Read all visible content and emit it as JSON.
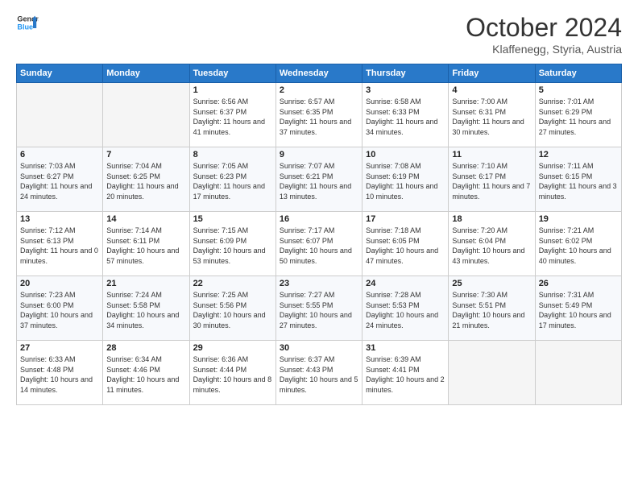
{
  "header": {
    "logo_general": "General",
    "logo_blue": "Blue",
    "month_title": "October 2024",
    "subtitle": "Klaffenegg, Styria, Austria"
  },
  "days_of_week": [
    "Sunday",
    "Monday",
    "Tuesday",
    "Wednesday",
    "Thursday",
    "Friday",
    "Saturday"
  ],
  "weeks": [
    [
      {
        "day": "",
        "sunrise": "",
        "sunset": "",
        "daylight": ""
      },
      {
        "day": "",
        "sunrise": "",
        "sunset": "",
        "daylight": ""
      },
      {
        "day": "1",
        "sunrise": "Sunrise: 6:56 AM",
        "sunset": "Sunset: 6:37 PM",
        "daylight": "Daylight: 11 hours and 41 minutes."
      },
      {
        "day": "2",
        "sunrise": "Sunrise: 6:57 AM",
        "sunset": "Sunset: 6:35 PM",
        "daylight": "Daylight: 11 hours and 37 minutes."
      },
      {
        "day": "3",
        "sunrise": "Sunrise: 6:58 AM",
        "sunset": "Sunset: 6:33 PM",
        "daylight": "Daylight: 11 hours and 34 minutes."
      },
      {
        "day": "4",
        "sunrise": "Sunrise: 7:00 AM",
        "sunset": "Sunset: 6:31 PM",
        "daylight": "Daylight: 11 hours and 30 minutes."
      },
      {
        "day": "5",
        "sunrise": "Sunrise: 7:01 AM",
        "sunset": "Sunset: 6:29 PM",
        "daylight": "Daylight: 11 hours and 27 minutes."
      }
    ],
    [
      {
        "day": "6",
        "sunrise": "Sunrise: 7:03 AM",
        "sunset": "Sunset: 6:27 PM",
        "daylight": "Daylight: 11 hours and 24 minutes."
      },
      {
        "day": "7",
        "sunrise": "Sunrise: 7:04 AM",
        "sunset": "Sunset: 6:25 PM",
        "daylight": "Daylight: 11 hours and 20 minutes."
      },
      {
        "day": "8",
        "sunrise": "Sunrise: 7:05 AM",
        "sunset": "Sunset: 6:23 PM",
        "daylight": "Daylight: 11 hours and 17 minutes."
      },
      {
        "day": "9",
        "sunrise": "Sunrise: 7:07 AM",
        "sunset": "Sunset: 6:21 PM",
        "daylight": "Daylight: 11 hours and 13 minutes."
      },
      {
        "day": "10",
        "sunrise": "Sunrise: 7:08 AM",
        "sunset": "Sunset: 6:19 PM",
        "daylight": "Daylight: 11 hours and 10 minutes."
      },
      {
        "day": "11",
        "sunrise": "Sunrise: 7:10 AM",
        "sunset": "Sunset: 6:17 PM",
        "daylight": "Daylight: 11 hours and 7 minutes."
      },
      {
        "day": "12",
        "sunrise": "Sunrise: 7:11 AM",
        "sunset": "Sunset: 6:15 PM",
        "daylight": "Daylight: 11 hours and 3 minutes."
      }
    ],
    [
      {
        "day": "13",
        "sunrise": "Sunrise: 7:12 AM",
        "sunset": "Sunset: 6:13 PM",
        "daylight": "Daylight: 11 hours and 0 minutes."
      },
      {
        "day": "14",
        "sunrise": "Sunrise: 7:14 AM",
        "sunset": "Sunset: 6:11 PM",
        "daylight": "Daylight: 10 hours and 57 minutes."
      },
      {
        "day": "15",
        "sunrise": "Sunrise: 7:15 AM",
        "sunset": "Sunset: 6:09 PM",
        "daylight": "Daylight: 10 hours and 53 minutes."
      },
      {
        "day": "16",
        "sunrise": "Sunrise: 7:17 AM",
        "sunset": "Sunset: 6:07 PM",
        "daylight": "Daylight: 10 hours and 50 minutes."
      },
      {
        "day": "17",
        "sunrise": "Sunrise: 7:18 AM",
        "sunset": "Sunset: 6:05 PM",
        "daylight": "Daylight: 10 hours and 47 minutes."
      },
      {
        "day": "18",
        "sunrise": "Sunrise: 7:20 AM",
        "sunset": "Sunset: 6:04 PM",
        "daylight": "Daylight: 10 hours and 43 minutes."
      },
      {
        "day": "19",
        "sunrise": "Sunrise: 7:21 AM",
        "sunset": "Sunset: 6:02 PM",
        "daylight": "Daylight: 10 hours and 40 minutes."
      }
    ],
    [
      {
        "day": "20",
        "sunrise": "Sunrise: 7:23 AM",
        "sunset": "Sunset: 6:00 PM",
        "daylight": "Daylight: 10 hours and 37 minutes."
      },
      {
        "day": "21",
        "sunrise": "Sunrise: 7:24 AM",
        "sunset": "Sunset: 5:58 PM",
        "daylight": "Daylight: 10 hours and 34 minutes."
      },
      {
        "day": "22",
        "sunrise": "Sunrise: 7:25 AM",
        "sunset": "Sunset: 5:56 PM",
        "daylight": "Daylight: 10 hours and 30 minutes."
      },
      {
        "day": "23",
        "sunrise": "Sunrise: 7:27 AM",
        "sunset": "Sunset: 5:55 PM",
        "daylight": "Daylight: 10 hours and 27 minutes."
      },
      {
        "day": "24",
        "sunrise": "Sunrise: 7:28 AM",
        "sunset": "Sunset: 5:53 PM",
        "daylight": "Daylight: 10 hours and 24 minutes."
      },
      {
        "day": "25",
        "sunrise": "Sunrise: 7:30 AM",
        "sunset": "Sunset: 5:51 PM",
        "daylight": "Daylight: 10 hours and 21 minutes."
      },
      {
        "day": "26",
        "sunrise": "Sunrise: 7:31 AM",
        "sunset": "Sunset: 5:49 PM",
        "daylight": "Daylight: 10 hours and 17 minutes."
      }
    ],
    [
      {
        "day": "27",
        "sunrise": "Sunrise: 6:33 AM",
        "sunset": "Sunset: 4:48 PM",
        "daylight": "Daylight: 10 hours and 14 minutes."
      },
      {
        "day": "28",
        "sunrise": "Sunrise: 6:34 AM",
        "sunset": "Sunset: 4:46 PM",
        "daylight": "Daylight: 10 hours and 11 minutes."
      },
      {
        "day": "29",
        "sunrise": "Sunrise: 6:36 AM",
        "sunset": "Sunset: 4:44 PM",
        "daylight": "Daylight: 10 hours and 8 minutes."
      },
      {
        "day": "30",
        "sunrise": "Sunrise: 6:37 AM",
        "sunset": "Sunset: 4:43 PM",
        "daylight": "Daylight: 10 hours and 5 minutes."
      },
      {
        "day": "31",
        "sunrise": "Sunrise: 6:39 AM",
        "sunset": "Sunset: 4:41 PM",
        "daylight": "Daylight: 10 hours and 2 minutes."
      },
      {
        "day": "",
        "sunrise": "",
        "sunset": "",
        "daylight": ""
      },
      {
        "day": "",
        "sunrise": "",
        "sunset": "",
        "daylight": ""
      }
    ]
  ]
}
